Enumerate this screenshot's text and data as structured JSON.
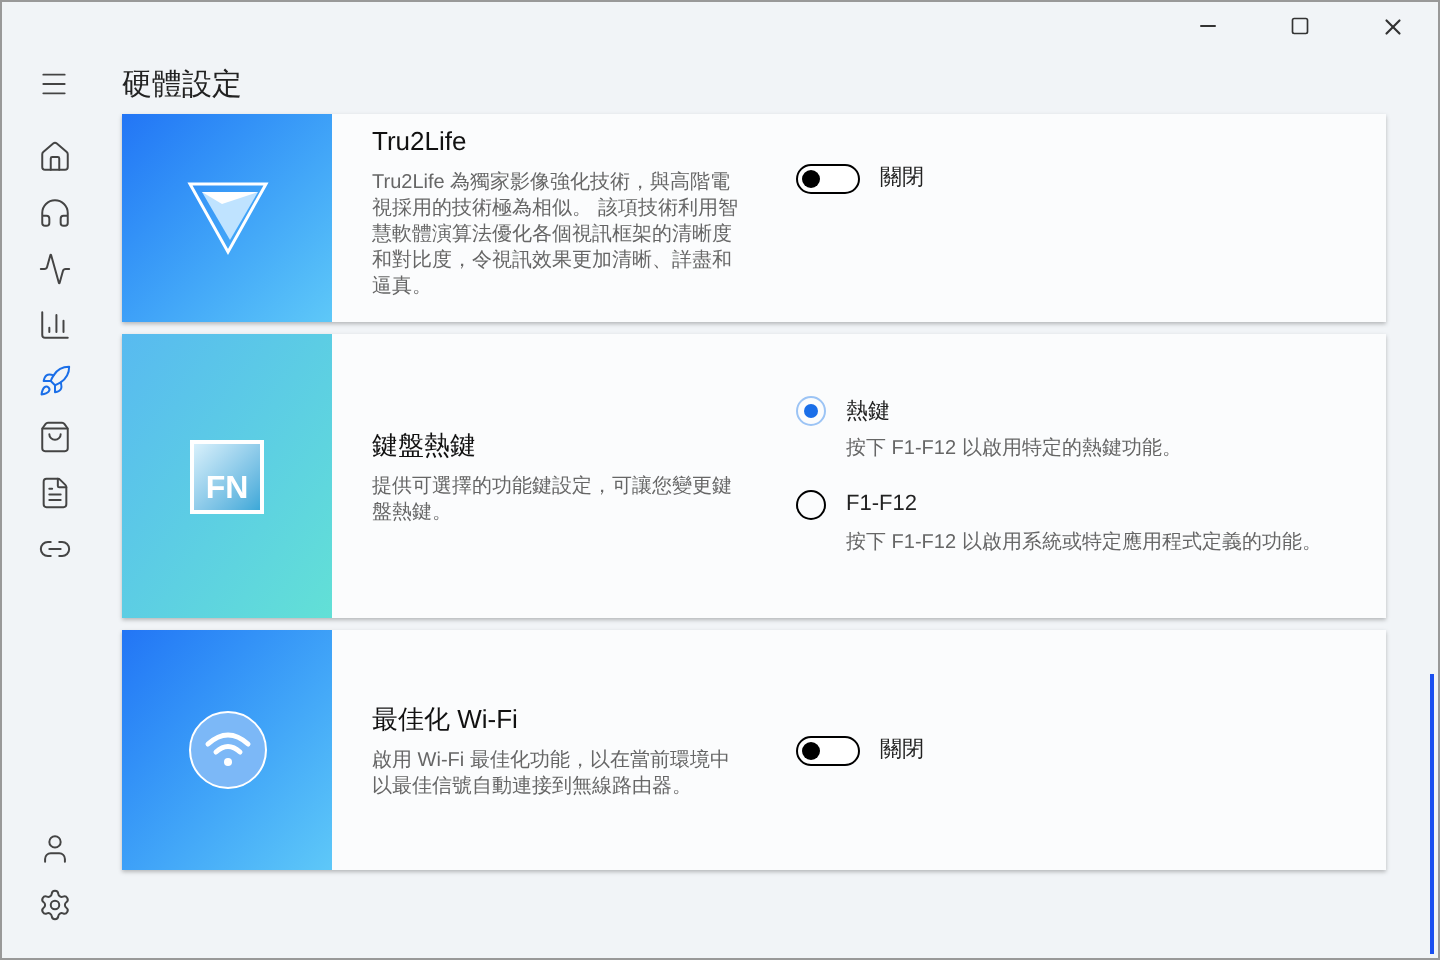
{
  "sidebar": {
    "items": [
      {
        "kind": "home",
        "selected": false
      },
      {
        "kind": "headphones",
        "selected": false
      },
      {
        "kind": "diagnosis",
        "selected": false
      },
      {
        "kind": "chart",
        "selected": false
      },
      {
        "kind": "rocket",
        "selected": true
      },
      {
        "kind": "bag",
        "selected": false
      },
      {
        "kind": "document",
        "selected": false
      },
      {
        "kind": "link",
        "selected": false
      }
    ],
    "bottom_items": [
      {
        "kind": "user",
        "selected": false
      },
      {
        "kind": "settings",
        "selected": false
      }
    ]
  },
  "page_title": "硬體設定",
  "cards": [
    {
      "kind": "toggle",
      "banner": {
        "kind": "triangle"
      },
      "title": "Tru2Life",
      "description": "Tru2Life 為獨家影像強化技術，與高階電視採用的技術極為相似。 該項技術利用智慧軟體演算法優化各個視訊框架的清晰度和對比度，令視訊效果更加清晰、詳盡和逼真。",
      "toggle": {
        "on": false,
        "label": "關閉"
      }
    },
    {
      "kind": "radio",
      "banner": {
        "kind": "fn",
        "text": "FN"
      },
      "title": "鍵盤熱鍵",
      "description": "提供可選擇的功能鍵設定，可讓您變更鍵盤熱鍵。",
      "options": [
        {
          "label": "熱鍵",
          "hint": "按下 F1-F12 以啟用特定的熱鍵功能。",
          "selected": true
        },
        {
          "label": "F1-F12",
          "hint": "按下 F1-F12 以啟用系統或特定應用程式定義的功能。",
          "selected": false
        }
      ]
    },
    {
      "kind": "toggle",
      "banner": {
        "kind": "wifi"
      },
      "title": "最佳化 Wi-Fi",
      "description": "啟用 Wi-Fi 最佳化功能，以在當前環境中以最佳信號自動連接到無線路由器。",
      "toggle": {
        "on": false,
        "label": "關閉"
      }
    }
  ]
}
